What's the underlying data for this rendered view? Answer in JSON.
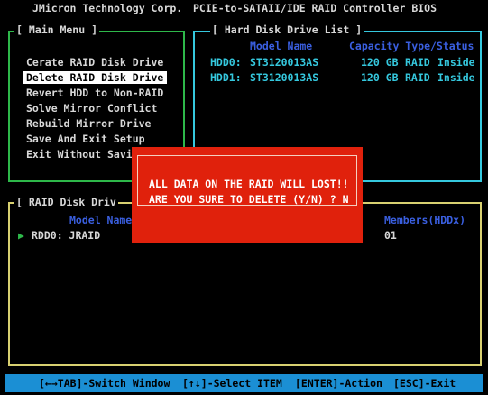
{
  "header": {
    "vendor": "JMicron Technology Corp.",
    "product": "PCIE-to-SATAII/IDE RAID Controller BIOS"
  },
  "main_menu": {
    "title": "[ Main Menu ]",
    "items": [
      {
        "label": "Cerate RAID Disk Drive"
      },
      {
        "label": "Delete RAID Disk Drive"
      },
      {
        "label": "Revert HDD to Non-RAID"
      },
      {
        "label": "Solve Mirror Conflict"
      },
      {
        "label": "Rebuild Mirror Drive"
      },
      {
        "label": "Save And Exit Setup"
      },
      {
        "label": "Exit Without Savi"
      }
    ],
    "selected_index": 1
  },
  "hdd_list": {
    "title": "[ Hard Disk Drive List ]",
    "col_model": "Model Name",
    "col_capacity": "Capacity Type/Status",
    "rows": [
      {
        "port": "HDD0:",
        "model": "ST3120013AS",
        "capacity": "120 GB",
        "type": "RAID",
        "status": "Inside"
      },
      {
        "port": "HDD1:",
        "model": "ST3120013AS",
        "capacity": "120 GB",
        "type": "RAID",
        "status": "Inside"
      }
    ]
  },
  "raid_list": {
    "title": "[ RAID Disk Driv",
    "col_model": "Model Name",
    "col_members": "Members(HDDx)",
    "rows": [
      {
        "arrow": "▶",
        "name": "RDD0: JRAID",
        "members": "01"
      }
    ]
  },
  "dialog": {
    "line1": "ALL DATA ON THE RAID WILL LOST!!",
    "line2": "ARE YOU SURE TO DELETE (Y/N) ? N"
  },
  "status_bar": {
    "switch": "[←→TAB]-Switch Window",
    "select": "[↑↓]-Select ITEM",
    "action": "[ENTER]-Action",
    "exit": "[ESC]-Exit"
  },
  "colors": {
    "main_menu_border": "#2eb84a",
    "hdd_border": "#35c8de",
    "raid_border": "#d8d070",
    "dialog_bg": "#e0210c",
    "status_bg": "#1b8fd4"
  }
}
